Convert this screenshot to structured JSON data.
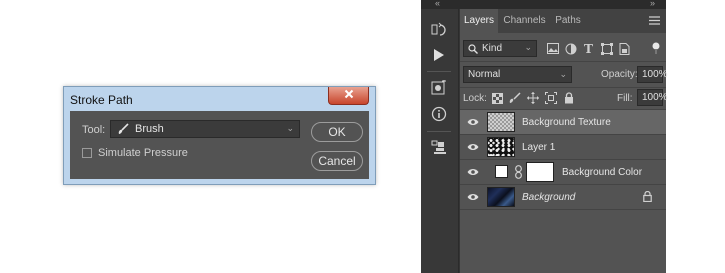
{
  "dialog": {
    "title": "Stroke Path",
    "tool_label": "Tool:",
    "tool_value": "Brush",
    "simulate_pressure_label": "Simulate Pressure",
    "simulate_pressure_checked": false,
    "ok_label": "OK",
    "cancel_label": "Cancel"
  },
  "panel": {
    "tabs": [
      {
        "label": "Layers",
        "active": true
      },
      {
        "label": "Channels",
        "active": false
      },
      {
        "label": "Paths",
        "active": false
      }
    ],
    "filter_kind": "Kind",
    "blend_mode": "Normal",
    "opacity_label": "Opacity:",
    "opacity_value": "100%",
    "lock_label": "Lock:",
    "fill_label": "Fill:",
    "fill_value": "100%",
    "layers": [
      {
        "name": "Background Texture",
        "selected": true,
        "visible": true
      },
      {
        "name": "Layer 1",
        "selected": false,
        "visible": true
      },
      {
        "name": "Background Color",
        "selected": false,
        "visible": true
      },
      {
        "name": "Background",
        "selected": false,
        "visible": true,
        "locked": true
      }
    ]
  },
  "colors": {
    "panel_bg": "#535353",
    "tab_bar": "#424242",
    "selected_layer": "#666666",
    "dialog_frame": "#bcd4ec",
    "close_button": "#c8452c"
  }
}
